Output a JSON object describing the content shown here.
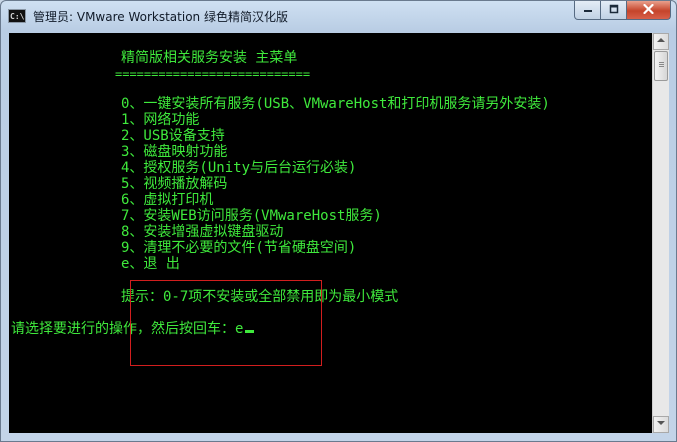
{
  "window": {
    "title": "管理员:  VMware Workstation 绿色精简汉化版",
    "icon_label": "C:\\"
  },
  "controls": {
    "minimize_icon": "minimize-icon",
    "maximize_icon": "maximize-icon",
    "close_icon": "close-icon"
  },
  "console": {
    "menu_title": "精简版相关服务安装 主菜单",
    "separator": "===========================",
    "items": [
      "0、一键安装所有服务(USB、VMwareHost和打印机服务请另外安装)",
      "1、网络功能",
      "2、USB设备支持",
      "3、磁盘映射功能",
      "4、授权服务(Unity与后台运行必装)",
      "5、视频播放解码",
      "6、虚拟打印机",
      "7、安装WEB访问服务(VMwareHost服务)",
      "8、安装增强虚拟键盘驱动",
      "9、清理不必要的文件(节省硬盘空间)",
      "e、退   出"
    ],
    "hint": "提示：0-7项不安装或全部禁用即为最小模式",
    "prompt": "请选择要进行的操作，然后按回车：",
    "input_value": "e"
  },
  "colors": {
    "console_text": "#3fe93c",
    "console_bg": "#000000",
    "highlight_box": "#d21e1e"
  }
}
